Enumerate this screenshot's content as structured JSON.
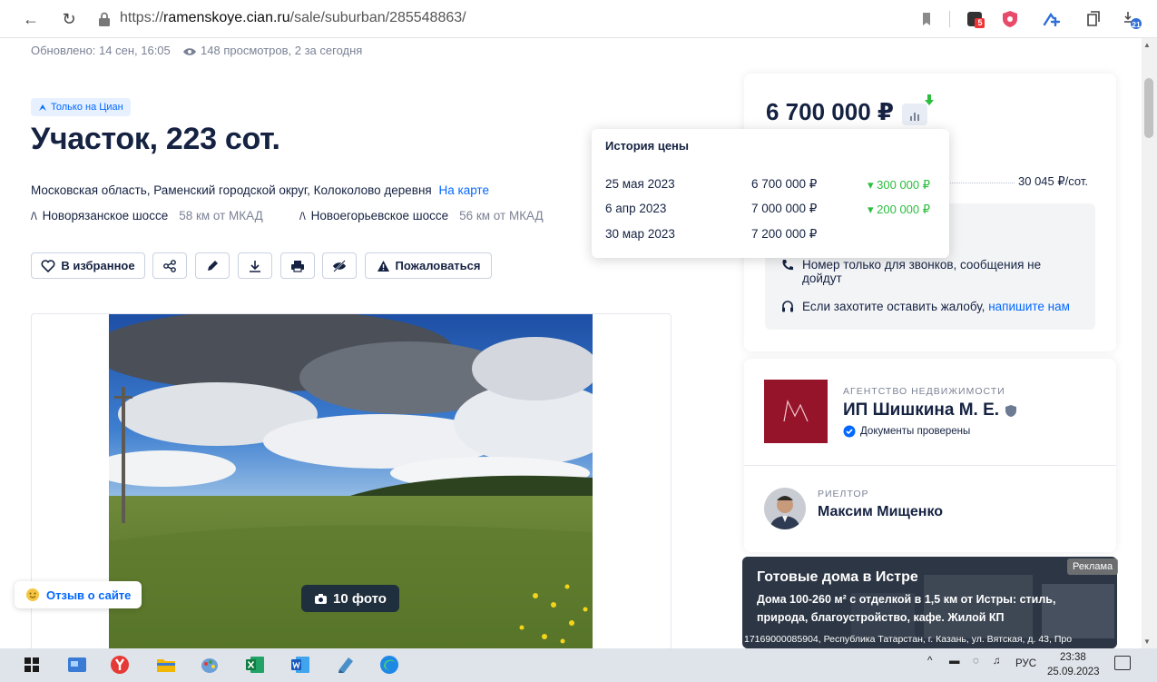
{
  "browser": {
    "url_prefix": "https://",
    "url_host": "ramenskoye.cian.ru",
    "url_path": "/sale/suburban/285548863/",
    "ext_badge_1": "5",
    "ext_badge_2": "21"
  },
  "listing": {
    "updated": "Обновлено: 14 сен, 16:05",
    "views": "148 просмотров, 2 за сегодня",
    "badge": "Только на Циан",
    "title": "Участок, 223 сот.",
    "address": "Московская область, Раменский городской округ, Колоколово деревня",
    "map_link": "На карте",
    "highways": [
      {
        "name": "Новорязанское шоссе",
        "distance": "58 км от МКАД"
      },
      {
        "name": "Новоегорьевское шоссе",
        "distance": "56 км от МКАД"
      }
    ],
    "favorite_label": "В избранное",
    "complain_label": "Пожаловаться",
    "photo_count": "10 фото"
  },
  "price": {
    "value": "6 700 000 ₽",
    "per_unit": "30 045 ₽/сот.",
    "calls_only": "Номер только для звонков, сообщения не",
    "calls_only_2": "дойдут",
    "complaint_text": "Если захотите оставить жалобу,",
    "complaint_link": "напишите нам"
  },
  "price_history": {
    "title": "История цены",
    "rows": [
      {
        "date": "25 мая 2023",
        "price": "6 700 000 ₽",
        "change": "300 000 ₽"
      },
      {
        "date": "6 апр 2023",
        "price": "7 000 000 ₽",
        "change": "200 000 ₽"
      },
      {
        "date": "30 мар 2023",
        "price": "7 200 000 ₽",
        "change": ""
      }
    ]
  },
  "agency": {
    "kind": "АГЕНТСТВО НЕДВИЖИМОСТИ",
    "name": "ИП Шишкина М. Е.",
    "docs": "Документы проверены"
  },
  "realtor": {
    "kind": "РИЕЛТОР",
    "name": "Максим Мищенко"
  },
  "ad": {
    "tag": "Реклама",
    "title": "Готовые дома в Истре",
    "text": "Дома 100-260 м² с отделкой в 1,5 км от Истры: стиль, природа, благоустройство, кафе. Жилой КП",
    "footer": "17169000085904, Республика Татарстан, г. Казань, ул. Вятская, д. 43, Про"
  },
  "feedback": "Отзыв о сайте",
  "taskbar": {
    "lang": "РУС",
    "time": "23:38",
    "date": "25.09.2023"
  },
  "colors": {
    "brand_blue": "#0468ff",
    "text_dark": "#152242",
    "price_drop_green": "#2bbd3e",
    "agency_red": "#96142a"
  }
}
